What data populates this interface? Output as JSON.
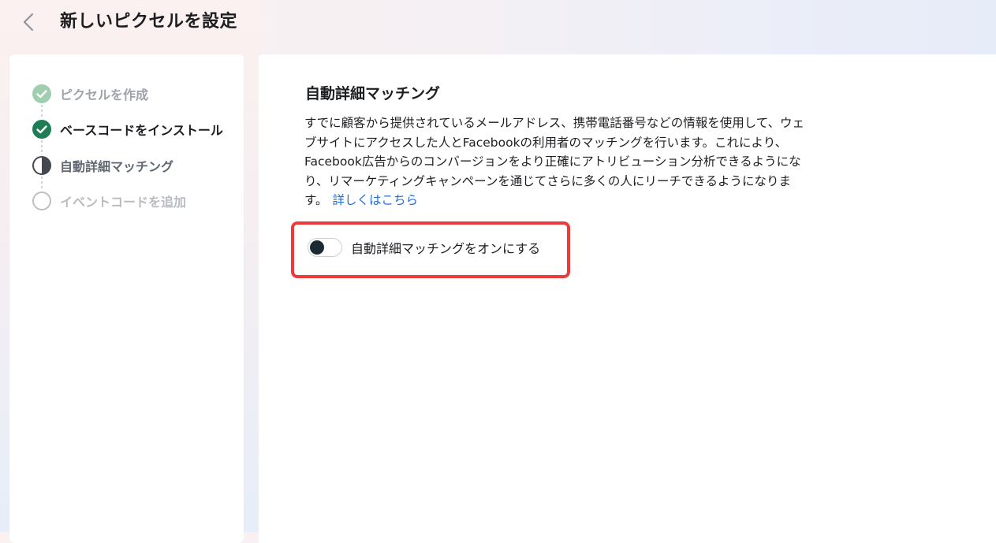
{
  "header": {
    "title": "新しいピクセルを設定",
    "back_icon": "chevron-left-icon"
  },
  "steps": [
    {
      "label": "ピクセルを作成",
      "state": "completed-faded",
      "icon": "check-circle-icon"
    },
    {
      "label": "ベースコードをインストール",
      "state": "completed",
      "icon": "check-circle-icon"
    },
    {
      "label": "自動詳細マッチング",
      "state": "current",
      "icon": "half-circle-icon"
    },
    {
      "label": "イベントコードを追加",
      "state": "pending",
      "icon": "empty-circle-icon"
    }
  ],
  "main": {
    "title": "自動詳細マッチング",
    "description_lines": [
      "すでに顧客から提供されているメールアドレス、携帯電話番号などの情報を使用して、ウェ",
      "ブサイトにアクセスした人とFacebookの利用者のマッチングを行います。これにより、",
      "Facebook広告からのコンバージョンをより正確にアトリビューション分析できるようにな",
      "り、リマーケティングキャンペーンを通じてさらに多くの人にリーチできるようになりま",
      "す。"
    ],
    "learn_more_link": "詳しくはこちら",
    "toggle": {
      "label": "自動詳細マッチングをオンにする",
      "on": false
    }
  },
  "colors": {
    "success_green": "#31a24c",
    "success_green_dark": "#1e7d55",
    "link_blue": "#216fdb",
    "highlight_red": "#ec3b3b",
    "toggle_knob": "#1c2b33"
  }
}
